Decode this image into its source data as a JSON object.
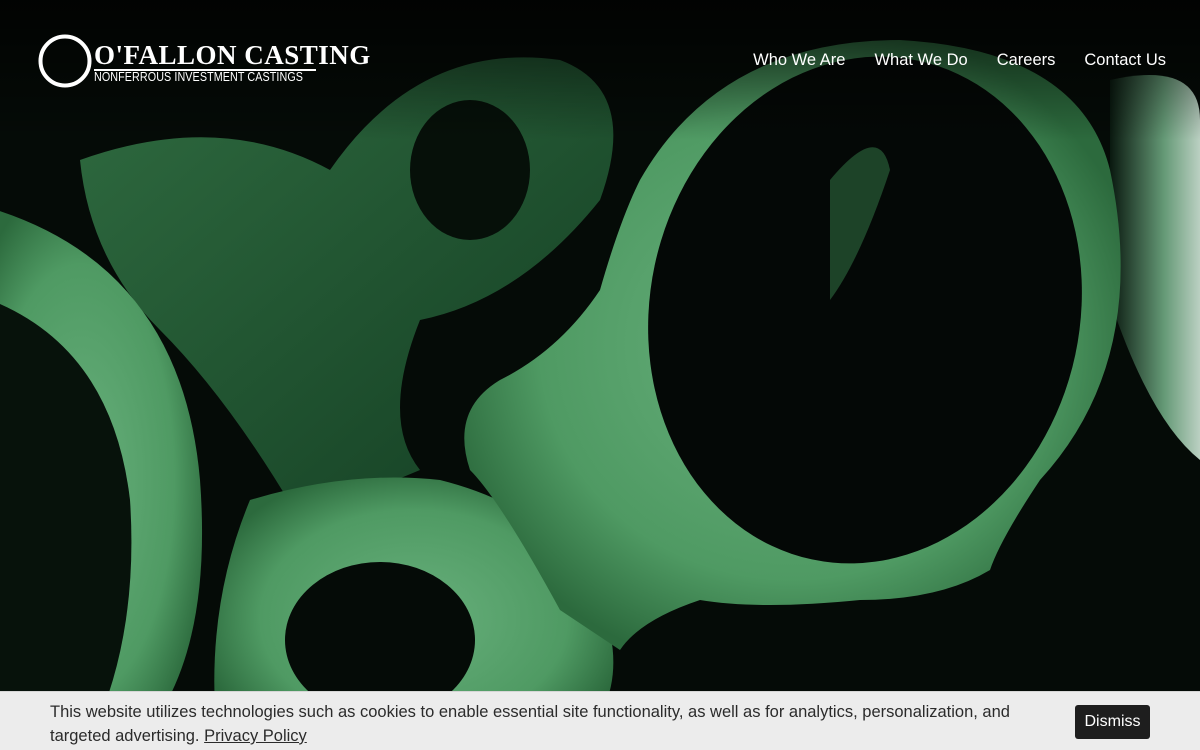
{
  "header": {
    "logo": {
      "brand": "O'FALLON CASTING",
      "tagline": "NONFERROUS INVESTMENT CASTINGS"
    },
    "nav": [
      {
        "label": "Who We Are"
      },
      {
        "label": "What We Do"
      },
      {
        "label": "Careers"
      },
      {
        "label": "Contact Us"
      }
    ]
  },
  "hero": {
    "image_subject": "green-tinted cast metal parts",
    "tint_color": "#4f9a63"
  },
  "cookie_banner": {
    "message": "This website utilizes technologies such as cookies to enable essential site functionality, as well as for analytics, personalization, and targeted advertising.",
    "privacy_link": "Privacy Policy",
    "dismiss_label": "Dismiss"
  }
}
